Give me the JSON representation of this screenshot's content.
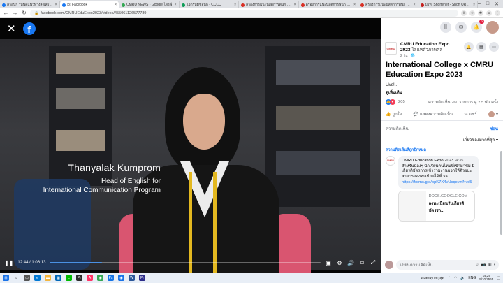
{
  "browser": {
    "tabs": [
      {
        "label": "ครอบีก าหนดแนวทางส่งเสริมก์",
        "color": "#1877f2",
        "active": false
      },
      {
        "label": "(8) Facebook",
        "color": "#1877f2",
        "active": true
      },
      {
        "label": "CMRU NEWS - Google ไดรฟ์",
        "color": "#34a853",
        "active": false
      },
      {
        "label": "แจกรหมขอนิก - CCCC",
        "color": "#0f9d58",
        "active": false
      },
      {
        "label": "ครองการแนะนิสิตการพนิก มะ.มะ-อ",
        "color": "#d93025",
        "active": false
      },
      {
        "label": "ครองการแนะนิสิตการพนิก มะ.มะ-อ",
        "color": "#d93025",
        "active": false
      },
      {
        "label": "ครองการแนะนิสิตการพนิก มะ.มะ-อ",
        "color": "#d93025",
        "active": false
      },
      {
        "label": "บริท. Shortener - Short URLs & C",
        "color": "#c5221f",
        "active": false
      }
    ],
    "url": "facebook.com/CMRUEduExpo2023/videos/455061126577789"
  },
  "video": {
    "lower_third_name": "Thanyalak Kumprom",
    "lower_third_role_1": "Head of English for",
    "lower_third_role_2": "International Communication Program",
    "time_label": "12:44 / 1:06:13",
    "progress_fraction": 0.192
  },
  "panel": {
    "notification_count": "6",
    "page_name": "CMRU Education Expo 2023",
    "follow_label": "ไล่แหตัวภาพศล",
    "post_meta": "2 วัน · 🌐",
    "post_title": "International College x CMRU Education Expo 2023",
    "post_text": "Live!..",
    "see_more": "ดูเพิ่มเติม",
    "reaction_count": "205",
    "stats_text": "ความคิดเห็น 260 รายการ  ดู 2.5 พัน ครั้ง",
    "like_label": "ถูกใจ",
    "comment_label": "แสดงความคิดเห็น",
    "share_label": "แชร์",
    "comments_heading": "ความคิดเห็น",
    "hide_label": "ซ่อน",
    "sort_label": "เกี่ยวข้องมากที่สุด",
    "top_fan_label": "ความคิดเห็นที่ถูกปักหมุด",
    "comment_author": "CMRU Education Expo 2023",
    "comment_time": "4:35",
    "comment_text": "สำหรับน้องๆ นักเรียนคนไหนที่เข้ามาชม มีเกียรติบัตรการเข้าร่วมงานแจกให้ด้วยนะ สามารถลงทะเบียนได้ที่ >>",
    "comment_link": "https://forms.gle/opK7X4vUsqsvmNvs5",
    "link_domain": "DOCS.GOOGLE.COM",
    "link_title": "ลงทะเบียนรับเกียรติบัตรรา...",
    "compose_placeholder": "เขียนความคิดเห็น..."
  },
  "taskbar": {
    "tray_text": "ENG",
    "weather": "ฝนตกทุก ครูสุด",
    "time": "14:29",
    "date": "5/10/2565"
  }
}
